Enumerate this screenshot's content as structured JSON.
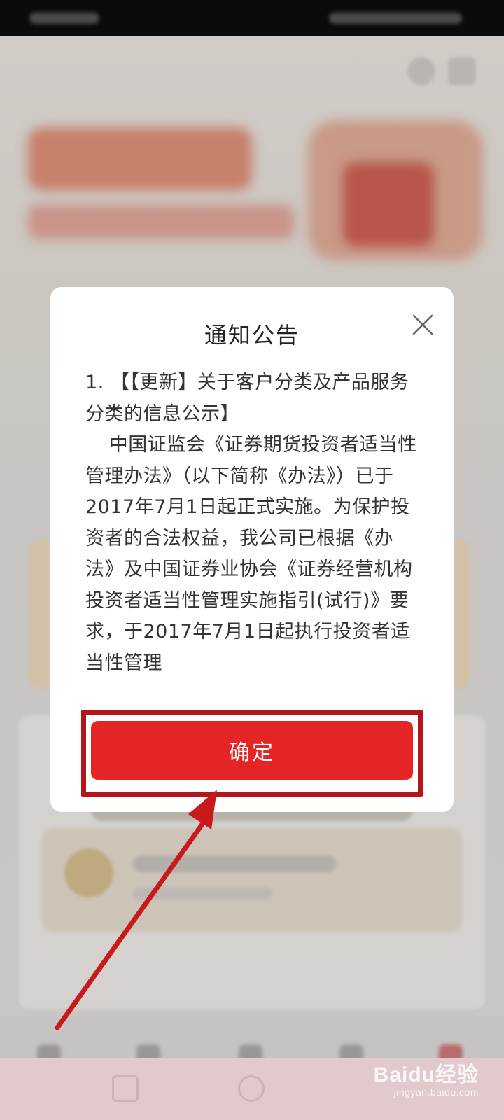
{
  "modal": {
    "title": "通知公告",
    "notice_heading": "1. 【【更新】关于客户分类及产品服务分类的信息公示】",
    "notice_paragraph": "中国证监会《证券期货投资者适当性管理办法》（以下简称《办法》）已于2017年7月1日起正式实施。为保护投资者的合法权益，我公司已根据《办法》及中国证券业协会《证券经营机构投资者适当性管理实施指引(试行)》要求，于2017年7月1日起执行投资者适当性管理",
    "confirm_label": "确定"
  },
  "icons": {
    "close": "close-icon",
    "annotation_arrow": "arrow-icon"
  },
  "watermark": {
    "brand": "Baidu经验",
    "domain": "jingyan.baidu.com"
  },
  "colors": {
    "confirm_button": "#e42425",
    "annotation": "#b5161b",
    "overlay": "#c9c6c1"
  }
}
